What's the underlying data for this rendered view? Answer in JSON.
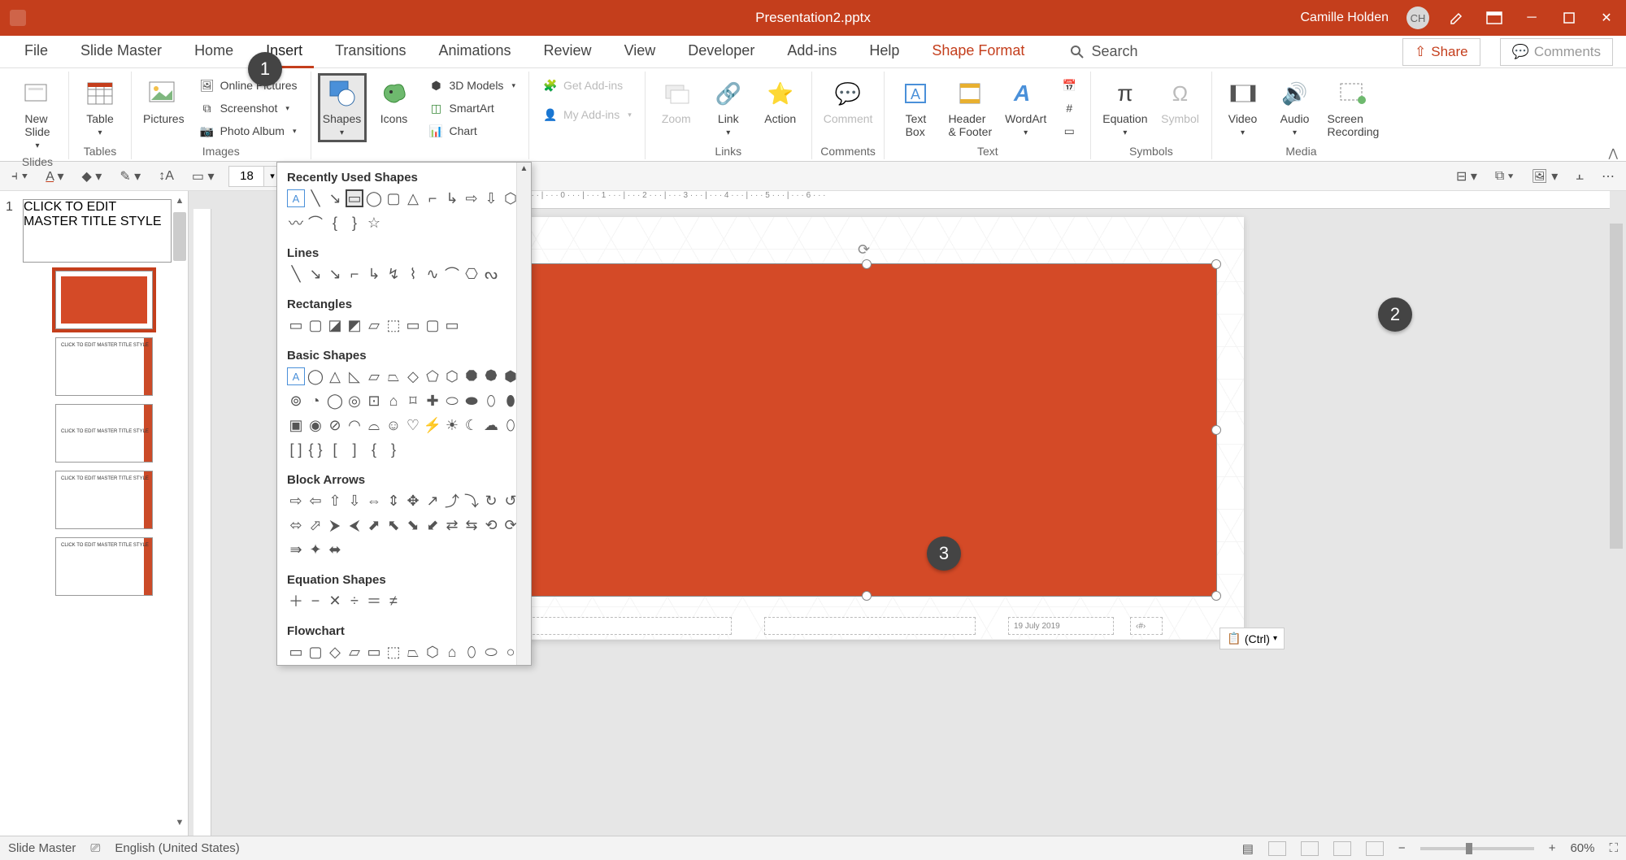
{
  "title": {
    "document": "Presentation2.pptx",
    "user": "Camille Holden",
    "user_initials": "CH"
  },
  "tabs": {
    "file": "File",
    "slide_master": "Slide Master",
    "home": "Home",
    "insert": "Insert",
    "transitions": "Transitions",
    "animations": "Animations",
    "review": "Review",
    "view": "View",
    "developer": "Developer",
    "addins": "Add-ins",
    "help": "Help",
    "shape_format": "Shape Format",
    "search": "Search",
    "share": "Share",
    "comments": "Comments"
  },
  "ribbon": {
    "new_slide": "New\nSlide",
    "table": "Table",
    "pictures": "Pictures",
    "online_pictures": "Online Pictures",
    "screenshot": "Screenshot",
    "photo_album": "Photo Album",
    "shapes": "Shapes",
    "icons": "Icons",
    "models3d": "3D Models",
    "smartart": "SmartArt",
    "chart": "Chart",
    "get_addins": "Get Add-ins",
    "my_addins": "My Add-ins",
    "zoom": "Zoom",
    "link": "Link",
    "action": "Action",
    "comment": "Comment",
    "text_box": "Text\nBox",
    "header_footer": "Header\n& Footer",
    "wordart": "WordArt",
    "equation": "Equation",
    "symbol": "Symbol",
    "video": "Video",
    "audio": "Audio",
    "screen_recording": "Screen\nRecording",
    "groups": {
      "slides": "Slides",
      "tables": "Tables",
      "images": "Images",
      "links": "Links",
      "comments": "Comments",
      "text": "Text",
      "symbols": "Symbols",
      "media": "Media"
    }
  },
  "qat": {
    "fontsize": "18"
  },
  "shapes_panel": {
    "recently_used": "Recently Used Shapes",
    "lines": "Lines",
    "rectangles": "Rectangles",
    "basic": "Basic Shapes",
    "block_arrows": "Block Arrows",
    "equation": "Equation Shapes",
    "flowchart": "Flowchart"
  },
  "slide": {
    "footer_date": "19 July 2019"
  },
  "paste": {
    "label": "(Ctrl)"
  },
  "status": {
    "mode": "Slide Master",
    "lang": "English (United States)",
    "zoom": "60%"
  },
  "callouts": {
    "c1": "1",
    "c2": "2",
    "c3": "3"
  }
}
